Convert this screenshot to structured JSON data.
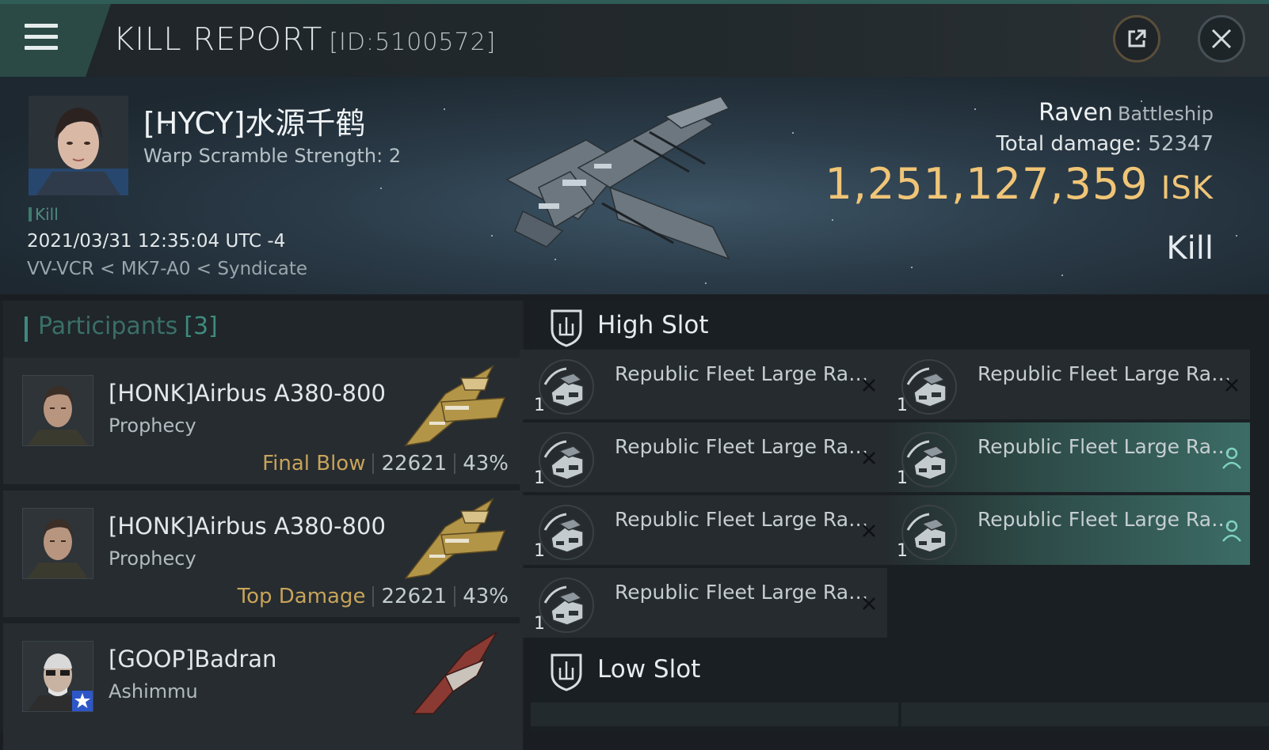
{
  "header": {
    "title": "KILL REPORT",
    "report_id": "[ID:5100572]"
  },
  "victim": {
    "name": "[HYCY]水源千鹤",
    "warp_scramble": "Warp Scramble Strength: 2",
    "kill_tag": "Kill",
    "datetime": "2021/03/31 12:35:04 UTC -4",
    "location": "VV-VCR < MK7-A0 < Syndicate",
    "ship_name": "Raven",
    "ship_class": "Battleship",
    "total_damage_label": "Total damage:",
    "total_damage": "52347",
    "isk_value": "1,251,127,359",
    "isk_unit": "ISK",
    "result": "Kill"
  },
  "participants": {
    "label": "Participants",
    "count": "[3]",
    "items": [
      {
        "name": "[HONK]Airbus A380-800",
        "ship": "Prophecy",
        "tag": "Final Blow",
        "damage": "22621",
        "percent": "43%"
      },
      {
        "name": "[HONK]Airbus A380-800",
        "ship": "Prophecy",
        "tag": "Top Damage",
        "damage": "22621",
        "percent": "43%"
      },
      {
        "name": "[GOOP]Badran",
        "ship": "Ashimmu",
        "tag": "",
        "damage": "",
        "percent": ""
      }
    ]
  },
  "high_slot": {
    "label": "High Slot",
    "items": [
      {
        "name": "Republic Fleet Large Rapid...",
        "qty": "1"
      },
      {
        "name": "Republic Fleet Large Rapid...",
        "qty": "1"
      },
      {
        "name": "Republic Fleet Large Rapid...",
        "qty": "1"
      },
      {
        "name": "Republic Fleet Large Rapid...",
        "qty": "1"
      },
      {
        "name": "Republic Fleet Large Rapid...",
        "qty": "1"
      },
      {
        "name": "Republic Fleet Large Rapid...",
        "qty": "1"
      },
      {
        "name": "Republic Fleet Large Rapid...",
        "qty": "1"
      }
    ]
  },
  "low_slot": {
    "label": "Low Slot"
  },
  "colors": {
    "accent_teal": "#3e8a7e",
    "isk_gold": "#f0c577",
    "tag_gold": "#c7a35a"
  }
}
